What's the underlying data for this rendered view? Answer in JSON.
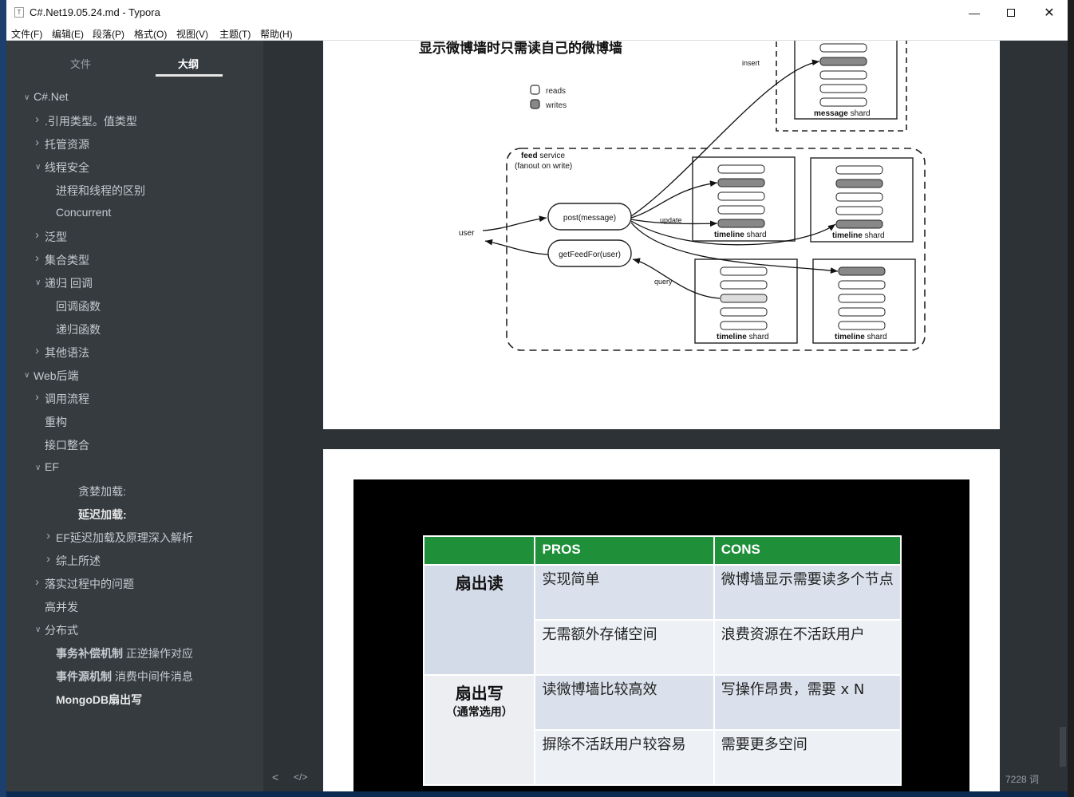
{
  "window": {
    "title": "C#.Net19.05.24.md - Typora"
  },
  "menu": [
    "文件(F)",
    "编辑(E)",
    "段落(P)",
    "格式(O)",
    "视图(V)",
    "主题(T)",
    "帮助(H)"
  ],
  "sidebar": {
    "tabs": [
      "文件",
      "大纲"
    ],
    "outline": [
      {
        "text": "C#.Net",
        "level": 0,
        "chev": "v"
      },
      {
        "text": ".引用类型。值类型",
        "level": 1,
        "chev": ">"
      },
      {
        "text": "托管资源",
        "level": 1,
        "chev": ">"
      },
      {
        "text": "线程安全",
        "level": 1,
        "chev": "v"
      },
      {
        "text": "进程和线程的区别",
        "level": 2,
        "chev": ""
      },
      {
        "text": "Concurrent",
        "level": 2,
        "chev": ""
      },
      {
        "text": "泛型",
        "level": 1,
        "chev": ">"
      },
      {
        "text": "集合类型",
        "level": 1,
        "chev": ">"
      },
      {
        "text": "递归 回调",
        "level": 1,
        "chev": "v"
      },
      {
        "text": "回调函数",
        "level": 2,
        "chev": ""
      },
      {
        "text": "递归函数",
        "level": 2,
        "chev": ""
      },
      {
        "text": "其他语法",
        "level": 1,
        "chev": ">"
      },
      {
        "text": "Web后端",
        "level": 0,
        "chev": "v"
      },
      {
        "text": "调用流程",
        "level": 1,
        "chev": ">"
      },
      {
        "text": "重构",
        "level": 1,
        "chev": ""
      },
      {
        "text": "接口整合",
        "level": 1,
        "chev": ""
      },
      {
        "text": "EF",
        "level": 1,
        "chev": "v"
      },
      {
        "text": "贪婪加载:",
        "level": 4,
        "chev": ""
      },
      {
        "text": "延迟加载:",
        "level": 4,
        "chev": "",
        "bold": true
      },
      {
        "text": "EF延迟加载及原理深入解析",
        "level": 2,
        "chev": ">"
      },
      {
        "text": "综上所述",
        "level": 2,
        "chev": ">"
      },
      {
        "text": "落实过程中的问题",
        "level": 1,
        "chev": ">"
      },
      {
        "text": "高并发",
        "level": 1,
        "chev": ""
      },
      {
        "text": "分布式",
        "level": 1,
        "chev": "v"
      },
      {
        "text": "事务补偿机制 正逆操作对应",
        "level": 2,
        "chev": "",
        "boldPrefix": "事务补偿机制"
      },
      {
        "text": "事件源机制 消费中间件消息",
        "level": 2,
        "chev": "",
        "boldPrefix": "事件源机制"
      },
      {
        "text": "MongoDB扇出写",
        "level": 2,
        "chev": "",
        "bold": true
      }
    ],
    "footer": {
      "left": "<",
      "right": "</>"
    }
  },
  "editor": {
    "wordcount": "7228 词",
    "diagram": {
      "heading": "显示微博墙时只需读自己的微博墙",
      "legend": [
        "reads",
        "writes"
      ],
      "service_title_bold": "feed",
      "service_title_rest": " service",
      "service_subtitle": "(fanout on write)",
      "user": "user",
      "post": "post(message)",
      "get": "getFeedFor(user)",
      "insert": "insert",
      "update": "update",
      "query": "query",
      "message_shard_bold": "message",
      "timeline_shard_bold": "timeline",
      "shard_suffix": " shard"
    },
    "table": {
      "headers": [
        "",
        "PROS",
        "CONS"
      ],
      "rows": [
        {
          "head": "扇出读",
          "sub": "",
          "pros": "实现简单",
          "cons": "微博墙显示需要读多个节点"
        },
        {
          "head": "",
          "sub": "",
          "pros": "无需额外存储空间",
          "cons": "浪费资源在不活跃用户"
        },
        {
          "head": "扇出写",
          "sub": "（通常选用）",
          "pros": "读微博墙比较高效",
          "cons": "写操作昂贵，需要 x N"
        },
        {
          "head": "",
          "sub": "",
          "pros": "摒除不活跃用户较容易",
          "cons": "需要更多空间"
        }
      ]
    }
  }
}
